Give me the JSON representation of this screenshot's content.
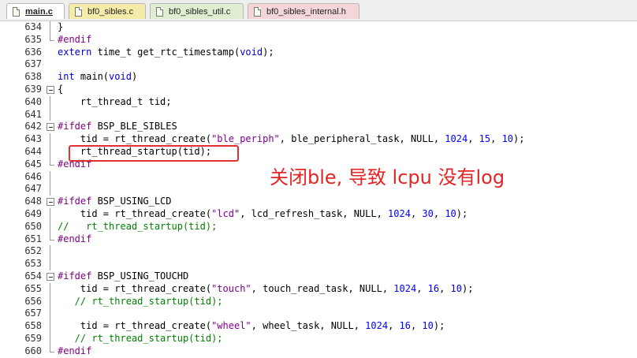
{
  "tabs": [
    {
      "label": "main.c",
      "style": "active"
    },
    {
      "label": "bf0_sibles.c",
      "style": "yellow"
    },
    {
      "label": "bf0_sibles_util.c",
      "style": "green"
    },
    {
      "label": "bf0_sibles_internal.h",
      "style": "pink"
    }
  ],
  "lines": [
    {
      "num": "634",
      "fold": "line",
      "parts": [
        {
          "t": "}",
          "c": ""
        }
      ]
    },
    {
      "num": "635",
      "fold": "corner",
      "parts": [
        {
          "t": "#endif",
          "c": "pp"
        }
      ]
    },
    {
      "num": "636",
      "fold": "",
      "parts": [
        {
          "t": "extern",
          "c": "kw"
        },
        {
          "t": " time_t get_rtc_timestamp(",
          "c": ""
        },
        {
          "t": "void",
          "c": "kw"
        },
        {
          "t": ");",
          "c": ""
        }
      ]
    },
    {
      "num": "637",
      "fold": "",
      "parts": []
    },
    {
      "num": "638",
      "fold": "",
      "parts": [
        {
          "t": "int",
          "c": "kw"
        },
        {
          "t": " main(",
          "c": ""
        },
        {
          "t": "void",
          "c": "kw"
        },
        {
          "t": ")",
          "c": ""
        }
      ]
    },
    {
      "num": "639",
      "fold": "box",
      "parts": [
        {
          "t": "{",
          "c": ""
        }
      ]
    },
    {
      "num": "640",
      "fold": "line",
      "parts": [
        {
          "t": "    rt_thread_t tid;",
          "c": ""
        }
      ]
    },
    {
      "num": "641",
      "fold": "line",
      "parts": []
    },
    {
      "num": "642",
      "fold": "box",
      "parts": [
        {
          "t": "#ifdef",
          "c": "pp"
        },
        {
          "t": " BSP_BLE_SIBLES",
          "c": ""
        }
      ]
    },
    {
      "num": "643",
      "fold": "line",
      "parts": [
        {
          "t": "    tid = rt_thread_create(",
          "c": ""
        },
        {
          "t": "\"ble_periph\"",
          "c": "str"
        },
        {
          "t": ", ble_peripheral_task, NULL, ",
          "c": ""
        },
        {
          "t": "1024",
          "c": "num"
        },
        {
          "t": ", ",
          "c": ""
        },
        {
          "t": "15",
          "c": "num"
        },
        {
          "t": ", ",
          "c": ""
        },
        {
          "t": "10",
          "c": "num"
        },
        {
          "t": ");",
          "c": ""
        }
      ]
    },
    {
      "num": "644",
      "fold": "line",
      "parts": [
        {
          "t": "    rt_thread_startup(tid);",
          "c": ""
        }
      ]
    },
    {
      "num": "645",
      "fold": "corner",
      "parts": [
        {
          "t": "#endif",
          "c": "pp"
        }
      ]
    },
    {
      "num": "646",
      "fold": "line",
      "parts": []
    },
    {
      "num": "647",
      "fold": "line",
      "parts": []
    },
    {
      "num": "648",
      "fold": "box",
      "parts": [
        {
          "t": "#ifdef",
          "c": "pp"
        },
        {
          "t": " BSP_USING_LCD",
          "c": ""
        }
      ]
    },
    {
      "num": "649",
      "fold": "line",
      "parts": [
        {
          "t": "    tid = rt_thread_create(",
          "c": ""
        },
        {
          "t": "\"lcd\"",
          "c": "str"
        },
        {
          "t": ", lcd_refresh_task, NULL, ",
          "c": ""
        },
        {
          "t": "1024",
          "c": "num"
        },
        {
          "t": ", ",
          "c": ""
        },
        {
          "t": "30",
          "c": "num"
        },
        {
          "t": ", ",
          "c": ""
        },
        {
          "t": "10",
          "c": "num"
        },
        {
          "t": ");",
          "c": ""
        }
      ]
    },
    {
      "num": "650",
      "fold": "line",
      "parts": [
        {
          "t": "//   rt_thread_startup(tid);",
          "c": "cm"
        }
      ]
    },
    {
      "num": "651",
      "fold": "corner",
      "parts": [
        {
          "t": "#endif",
          "c": "pp"
        }
      ]
    },
    {
      "num": "652",
      "fold": "line",
      "parts": []
    },
    {
      "num": "653",
      "fold": "line",
      "parts": []
    },
    {
      "num": "654",
      "fold": "box",
      "parts": [
        {
          "t": "#ifdef",
          "c": "pp"
        },
        {
          "t": " BSP_USING_TOUCHD",
          "c": ""
        }
      ]
    },
    {
      "num": "655",
      "fold": "line",
      "parts": [
        {
          "t": "    tid = rt_thread_create(",
          "c": ""
        },
        {
          "t": "\"touch\"",
          "c": "str"
        },
        {
          "t": ", touch_read_task, NULL, ",
          "c": ""
        },
        {
          "t": "1024",
          "c": "num"
        },
        {
          "t": ", ",
          "c": ""
        },
        {
          "t": "16",
          "c": "num"
        },
        {
          "t": ", ",
          "c": ""
        },
        {
          "t": "10",
          "c": "num"
        },
        {
          "t": ");",
          "c": ""
        }
      ]
    },
    {
      "num": "656",
      "fold": "line",
      "parts": [
        {
          "t": "   // rt_thread_startup(tid);",
          "c": "cm"
        }
      ]
    },
    {
      "num": "657",
      "fold": "line",
      "parts": []
    },
    {
      "num": "658",
      "fold": "line",
      "parts": [
        {
          "t": "    tid = rt_thread_create(",
          "c": ""
        },
        {
          "t": "\"wheel\"",
          "c": "str"
        },
        {
          "t": ", wheel_task, NULL, ",
          "c": ""
        },
        {
          "t": "1024",
          "c": "num"
        },
        {
          "t": ", ",
          "c": ""
        },
        {
          "t": "16",
          "c": "num"
        },
        {
          "t": ", ",
          "c": ""
        },
        {
          "t": "10",
          "c": "num"
        },
        {
          "t": ");",
          "c": ""
        }
      ]
    },
    {
      "num": "659",
      "fold": "line",
      "parts": [
        {
          "t": "   // rt_thread_startup(tid);",
          "c": "cm"
        }
      ]
    },
    {
      "num": "660",
      "fold": "corner",
      "parts": [
        {
          "t": "#endif",
          "c": "pp"
        }
      ]
    }
  ],
  "annotation": {
    "text": "关闭ble, 导致 lcpu 没有log",
    "color": "#e52525"
  },
  "colors": {
    "keyword": "#0000d0",
    "preprocessor": "#7f007f",
    "string": "#7f0090",
    "number": "#0000ff",
    "comment": "#008000",
    "highlight": "#e03030"
  }
}
